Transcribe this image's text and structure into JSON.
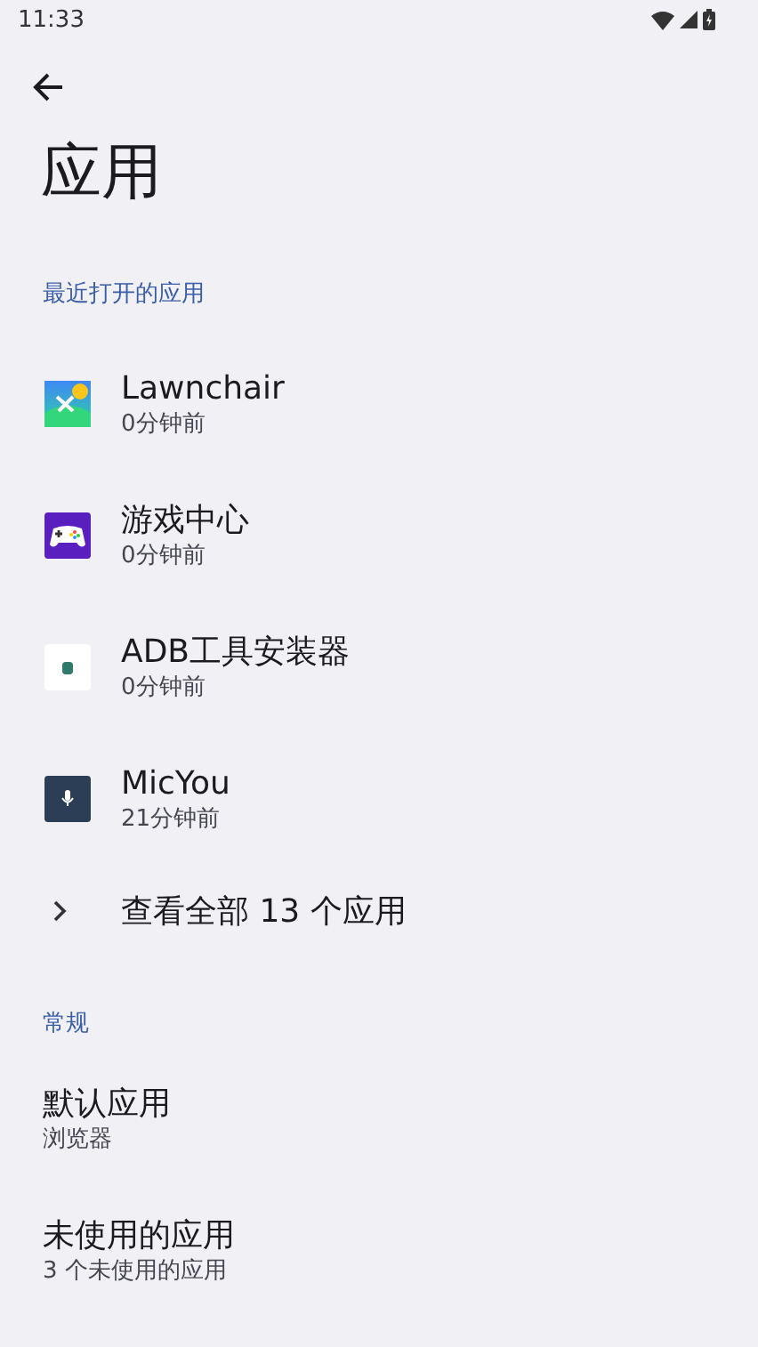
{
  "status_bar": {
    "time": "11:33"
  },
  "title": "应用",
  "recent": {
    "header": "最近打开的应用",
    "apps": [
      {
        "name": "Lawnchair",
        "time": "0分钟前"
      },
      {
        "name": "游戏中心",
        "time": "0分钟前"
      },
      {
        "name": "ADB工具安装器",
        "time": "0分钟前"
      },
      {
        "name": "MicYou",
        "time": "21分钟前"
      }
    ],
    "see_all": "查看全部 13 个应用"
  },
  "general": {
    "header": "常规",
    "items": [
      {
        "title": "默认应用",
        "summary": "浏览器"
      },
      {
        "title": "未使用的应用",
        "summary": "3 个未使用的应用"
      }
    ]
  }
}
